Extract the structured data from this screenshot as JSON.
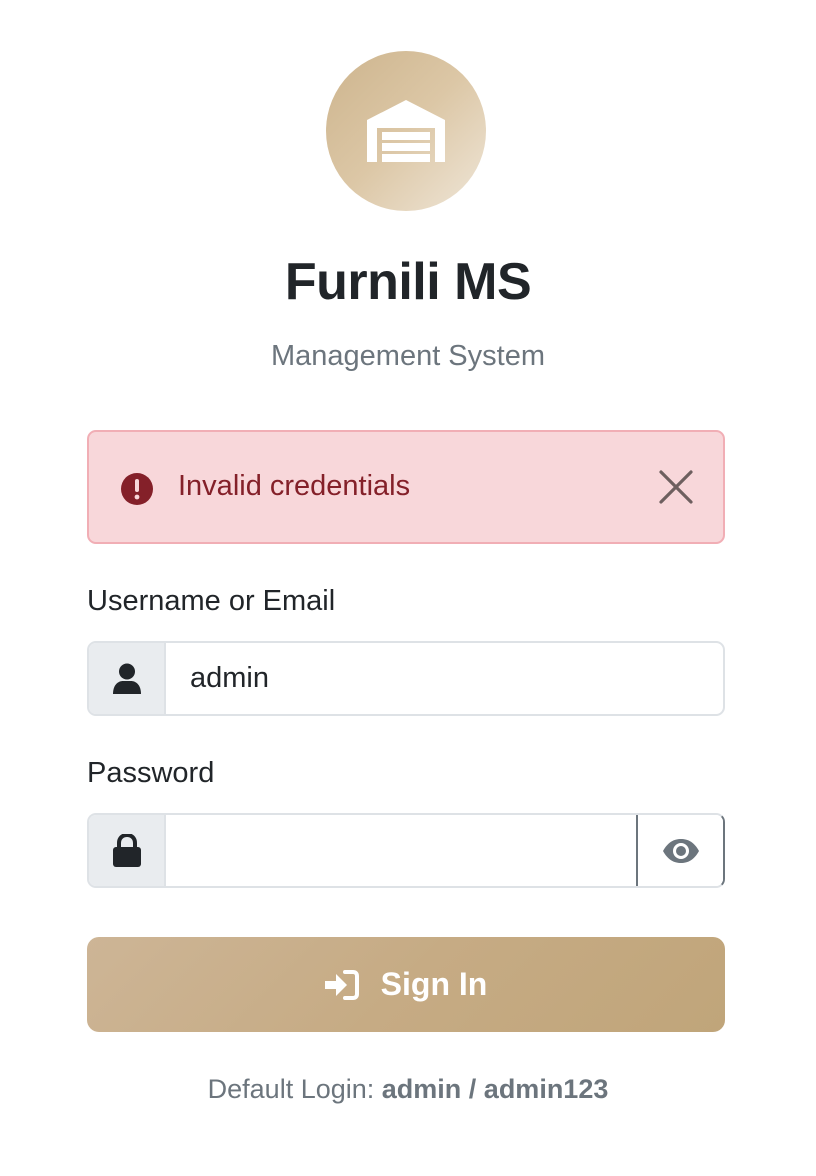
{
  "app": {
    "title": "Furnili MS",
    "subtitle": "Management System",
    "logo_icon": "warehouse-icon"
  },
  "alert": {
    "message": "Invalid credentials",
    "icon": "exclamation-circle-icon",
    "close_icon": "close-icon"
  },
  "form": {
    "username_label": "Username or Email",
    "username_value": "admin",
    "username_icon": "user-icon",
    "password_label": "Password",
    "password_value": "",
    "password_icon": "lock-icon",
    "toggle_icon": "eye-icon"
  },
  "signin": {
    "label": "Sign In",
    "icon": "sign-in-icon"
  },
  "hint": {
    "prefix": "Default Login: ",
    "username": "admin",
    "separator": " / ",
    "password": "admin123"
  },
  "colors": {
    "brand": "#c6ab84",
    "alert_bg": "#f8d7da",
    "alert_text": "#842029"
  }
}
